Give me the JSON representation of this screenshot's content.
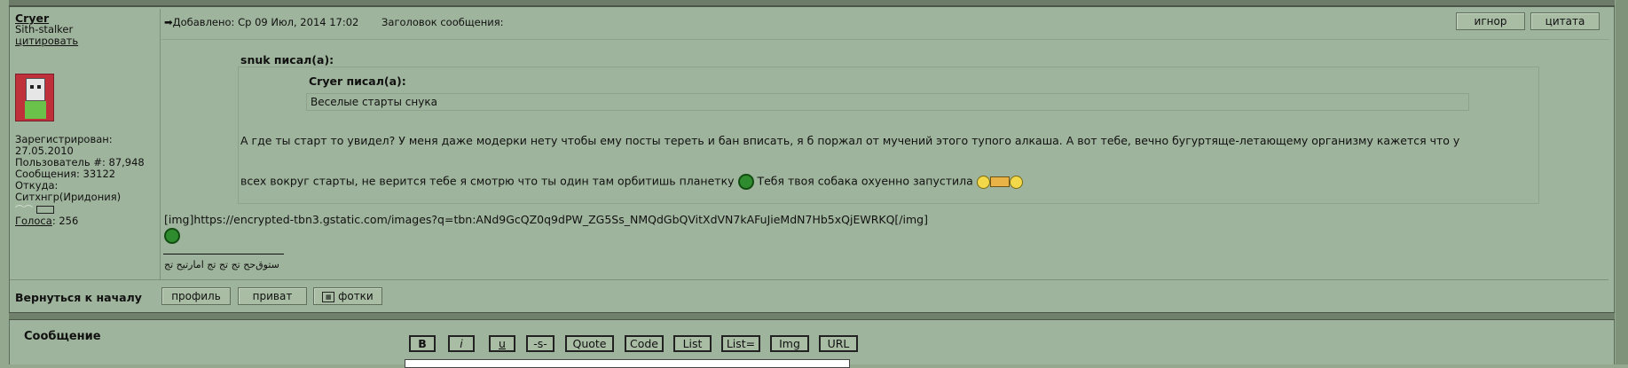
{
  "user": {
    "name": "Cryer",
    "title": "Sith-stalker",
    "quote_link": "цитировать",
    "registered_label": "Зарегистрирован:",
    "registered_date": "27.05.2010",
    "user_num": "Пользователь #: 87,948",
    "posts": "Сообщения: 33122",
    "from_label": "Откуда:",
    "from_value": "Ситхнгр(Иридония)",
    "votes_link": "Голоса",
    "votes_value": ": 256"
  },
  "post": {
    "added": "Добавлено: Ср 09 Июл, 2014 17:02",
    "subject_label": "Заголовок сообщения:",
    "ignore_button": "игнор",
    "quote_button": "цитата",
    "quote1_author": "snuk писал(а):",
    "quote2_author": "Cryer писал(а):",
    "quote2_text": "Веселые старты снука",
    "reply_line1": "А где ты старт то увидел? У меня даже модерки нету чтобы ему посты тереть и бан вписать, я б поржал от мучений этого тупого алкаша. А вот тебе, вечно бугуртяще-летающему организму кажется что у",
    "reply_line2a": "всех вокруг старты, не верится тебе я смотрю что ты один там орбитишь планетку",
    "reply_line2b": "Тебя твоя собака охуенно запустила",
    "img_text": "[img]https://encrypted-tbn3.gstatic.com/images?q=tbn:ANd9GcQZ0q9dPW_ZG5Ss_NMQdGbQVitXdVN7kAFuJieMdN7Hb5xQjEWRKQ[/img]",
    "signature": "ﺳﺘﻮﻕﺣﺢ ﺗﺞ ﺗﺞ ﺗﺞ ﺍﻣﺎﺭﺗﻴﺢ ﺗﺞ"
  },
  "footer": {
    "back_to_top": "Вернуться к началу",
    "profile_button": "профиль",
    "private_button": "приват",
    "photos_button": "фотки"
  },
  "editor": {
    "message_label": "Сообщение",
    "buttons": [
      "B",
      "i",
      "u",
      "-s-",
      "Quote",
      "Code",
      "List",
      "List=",
      "Img",
      "URL"
    ]
  }
}
